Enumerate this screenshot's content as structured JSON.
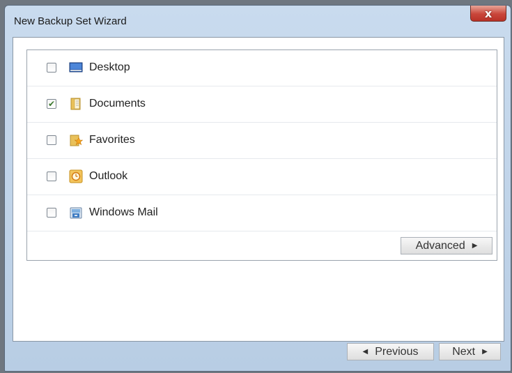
{
  "window": {
    "title": "New Backup Set Wizard",
    "close_glyph": "x"
  },
  "items": [
    {
      "label": "Desktop",
      "checked": false,
      "icon": "desktop-icon"
    },
    {
      "label": "Documents",
      "checked": true,
      "icon": "documents-folder-icon"
    },
    {
      "label": "Favorites",
      "checked": false,
      "icon": "favorites-folder-icon"
    },
    {
      "label": "Outlook",
      "checked": false,
      "icon": "outlook-icon"
    },
    {
      "label": "Windows Mail",
      "checked": false,
      "icon": "windows-mail-icon"
    }
  ],
  "buttons": {
    "advanced": "Advanced",
    "previous": "Previous",
    "next": "Next"
  },
  "colors": {
    "title_bar": "#c9dbee",
    "close_button": "#c9463a",
    "check_mark": "#3d7a2f"
  }
}
